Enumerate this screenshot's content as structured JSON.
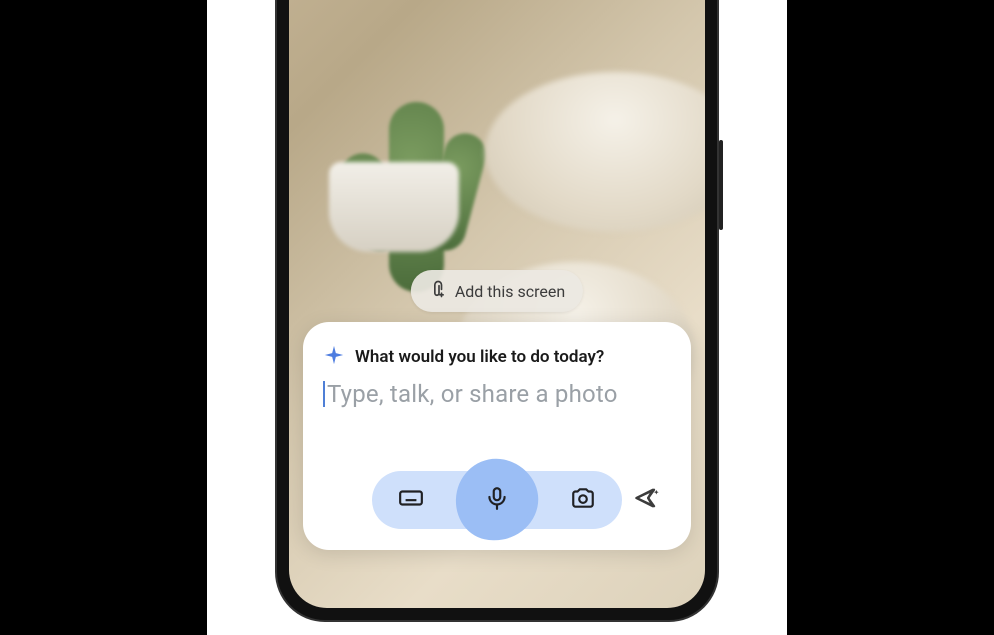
{
  "chip": {
    "label": "Add this screen"
  },
  "assistant": {
    "prompt": "What would you like to do today?",
    "placeholder": "Type, talk, or share a photo"
  },
  "icons": {
    "attach": "attach-icon",
    "sparkle": "sparkle-icon",
    "keyboard": "keyboard-icon",
    "mic": "microphone-icon",
    "camera": "camera-icon",
    "send": "send-sparkle-icon"
  }
}
